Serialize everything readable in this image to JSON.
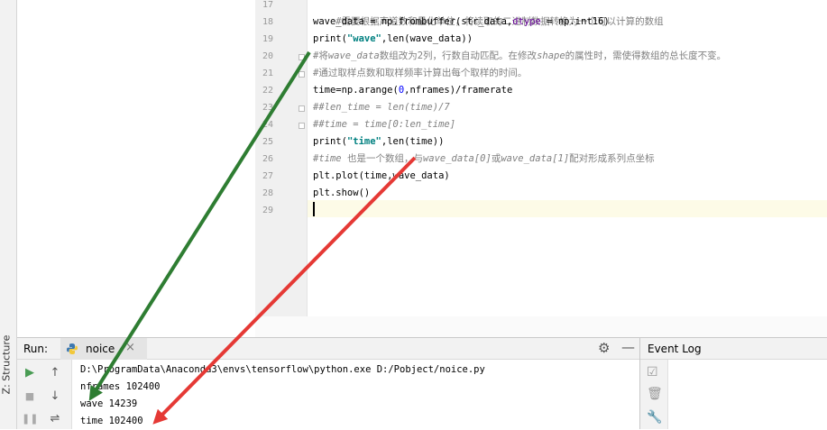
{
  "gutter": {
    "line_numbers": [
      "17",
      "18",
      "19",
      "20",
      "21",
      "22",
      "23",
      "24",
      "25",
      "26",
      "27",
      "28",
      "29"
    ]
  },
  "code": {
    "line17": "#需要根据声道数和量化单位，将读取的二进制数据转换为一个可以计算的数组",
    "line18": {
      "a": "wave_data = np.frombuffer(str_data,",
      "param": "dtype",
      "b": " = np.int16)"
    },
    "line19": {
      "a": "print(",
      "str": "\"wave\"",
      "b": ",len(wave_data))"
    },
    "line20": {
      "a": "#将",
      "b": "wave_data",
      "c": "数组改为2列，行数自动匹配。在修改",
      "d": "shape",
      "e": "的属性时，需使得数组的总长度不变。"
    },
    "line21": "#通过取样点数和取样频率计算出每个取样的时间。",
    "line22": {
      "a": "time=np.arange(",
      "num": "0",
      "b": ",nframes)/framerate"
    },
    "line23": "##len_time = len(time)/7",
    "line24": "##time = time[0:len_time]",
    "line25": {
      "a": "print(",
      "str": "\"time\"",
      "b": ",len(time))"
    },
    "line26": {
      "a": "#",
      "b": "time",
      "c": " 也是一个数组，与",
      "d": "wave_data[0]",
      "e": "或",
      "f": "wave_data[1]",
      "g": "配对形成系列点坐标"
    },
    "line27": "plt.plot(time,wave_data)",
    "line28": "plt.show()"
  },
  "run_panel": {
    "label": "Run:",
    "tab_label": "noice",
    "tab_icon": "python-icon",
    "console_lines": [
      "D:\\ProgramData\\Anaconda3\\envs\\tensorflow\\python.exe D:/Pobject/noice.py",
      "nframes 102400",
      "wave 14239",
      "time 102400"
    ]
  },
  "event_log": {
    "title": "Event Log"
  },
  "sidebar": {
    "structure_label": "Z: Structure"
  },
  "colors": {
    "arrow_green": "#2e7d32",
    "arrow_red": "#e53935",
    "current_line": "#fdfbe7",
    "run_green": "#499c54"
  }
}
